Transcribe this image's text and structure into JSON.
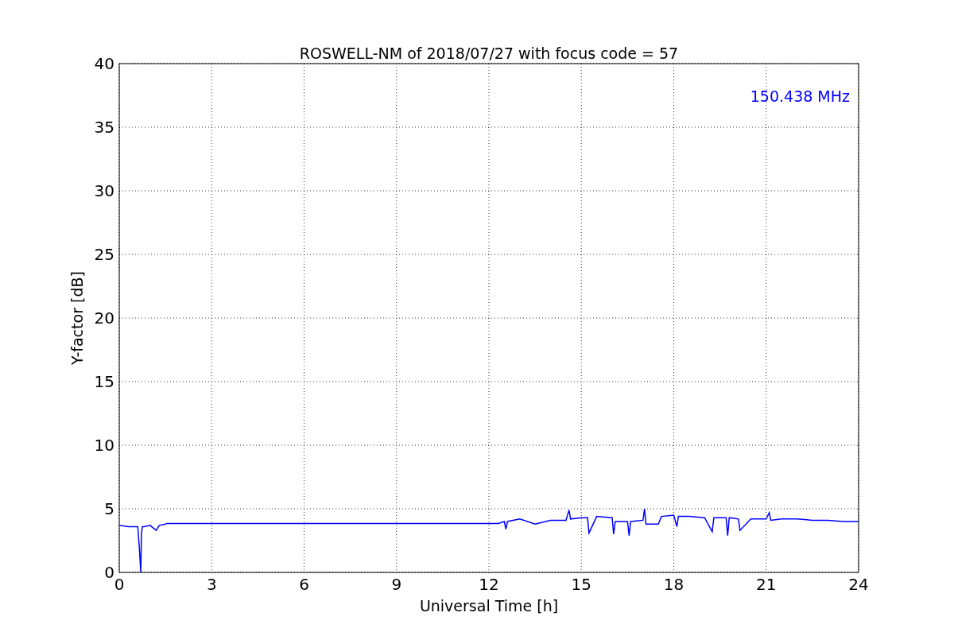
{
  "chart_data": {
    "type": "line",
    "title": "ROSWELL-NM of 2018/07/27 with focus code = 57",
    "xlabel": "Universal Time [h]",
    "ylabel": "Y-factor [dB]",
    "xlim": [
      0,
      24
    ],
    "ylim": [
      0,
      40
    ],
    "xticks": [
      0,
      3,
      6,
      9,
      12,
      15,
      18,
      21,
      24
    ],
    "yticks": [
      0,
      5,
      10,
      15,
      20,
      25,
      30,
      35,
      40
    ],
    "x": [
      0,
      0.3,
      0.6,
      0.65,
      0.7,
      0.72,
      0.75,
      0.8,
      1.0,
      1.2,
      1.3,
      1.5,
      1.55,
      12.3,
      12.5,
      12.55,
      12.6,
      13.0,
      13.5,
      14.0,
      14.5,
      14.6,
      14.65,
      15.0,
      15.2,
      15.25,
      15.5,
      16.0,
      16.05,
      16.1,
      16.5,
      16.55,
      16.6,
      17.0,
      17.05,
      17.1,
      17.5,
      17.6,
      18.0,
      18.1,
      18.15,
      18.5,
      19.0,
      19.25,
      19.3,
      19.7,
      19.75,
      19.8,
      20.1,
      20.15,
      20.5,
      21.0,
      21.1,
      21.15,
      21.5,
      22.0,
      22.5,
      23.0,
      23.5,
      24
    ],
    "series": [
      {
        "name": "150.438 MHz",
        "color": "#0000ff",
        "values": [
          3.7,
          3.6,
          3.6,
          2.0,
          0,
          3.0,
          3.6,
          3.6,
          3.7,
          3.3,
          3.7,
          3.8,
          3.85,
          3.85,
          4.0,
          3.4,
          4.0,
          4.2,
          3.8,
          4.1,
          4.1,
          4.9,
          4.2,
          4.3,
          4.3,
          3.1,
          4.4,
          4.3,
          3.0,
          4.0,
          4.0,
          2.9,
          4.0,
          4.1,
          5.0,
          3.8,
          3.8,
          4.4,
          4.5,
          3.6,
          4.4,
          4.4,
          4.3,
          3.2,
          4.3,
          4.3,
          2.9,
          4.3,
          4.2,
          3.3,
          4.2,
          4.2,
          4.7,
          4.1,
          4.2,
          4.2,
          4.1,
          4.1,
          4.0,
          4.0
        ]
      }
    ],
    "grid": true
  }
}
